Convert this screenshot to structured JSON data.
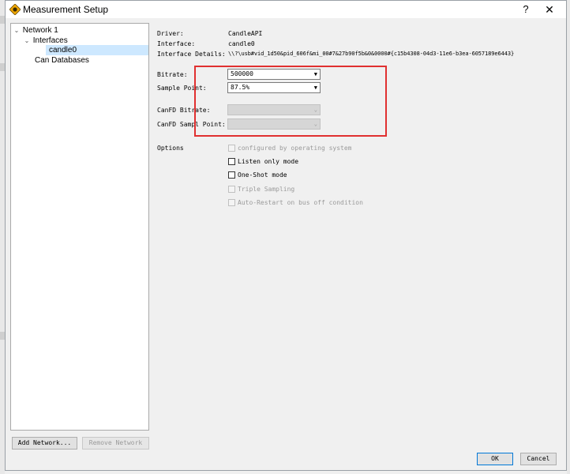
{
  "window": {
    "title": "Measurement Setup",
    "help_label": "?",
    "close_label": "✕"
  },
  "tree": {
    "items": [
      {
        "label": "Network 1",
        "expanded": true
      },
      {
        "label": "Interfaces",
        "expanded": true
      },
      {
        "label": "candle0",
        "selected": true
      },
      {
        "label": "Can Databases"
      }
    ]
  },
  "left_buttons": {
    "add_network": "Add Network...",
    "remove_network": "Remove Network"
  },
  "details": {
    "driver_label": "Driver:",
    "driver_value": "CandleAPI",
    "interface_label": "Interface:",
    "interface_value": "candle0",
    "interface_details_label": "Interface Details:",
    "interface_details_value": "\\\\?\\usb#vid_1d50&pid_606f&mi_00#7&27b90f5b&0&0000#{c15b4308-04d3-11e6-b3ea-6057189e6443}"
  },
  "settings": {
    "bitrate_label": "Bitrate:",
    "bitrate_value": "500000",
    "sample_point_label": "Sample Point:",
    "sample_point_value": "87.5%",
    "canfd_bitrate_label": "CanFD Bitrate:",
    "canfd_bitrate_value": "",
    "canfd_sample_point_label": "CanFD Sampl Point:",
    "canfd_sample_point_value": ""
  },
  "options": {
    "label": "Options",
    "items": [
      {
        "label": "configured by operating system",
        "checked": false,
        "enabled": false
      },
      {
        "label": "Listen only mode",
        "checked": false,
        "enabled": true
      },
      {
        "label": "One-Shot mode",
        "checked": false,
        "enabled": true
      },
      {
        "label": "Triple Sampling",
        "checked": false,
        "enabled": false
      },
      {
        "label": "Auto-Restart on bus off condition",
        "checked": false,
        "enabled": false
      }
    ]
  },
  "footer": {
    "ok_label": "OK",
    "cancel_label": "Cancel"
  },
  "colors": {
    "highlight_box": "#e03030",
    "selection": "#cde8ff"
  },
  "icons": {
    "window_icon": "can-app-icon",
    "expand": "chevron-down-icon",
    "dropdown": "chevron-down-icon"
  }
}
